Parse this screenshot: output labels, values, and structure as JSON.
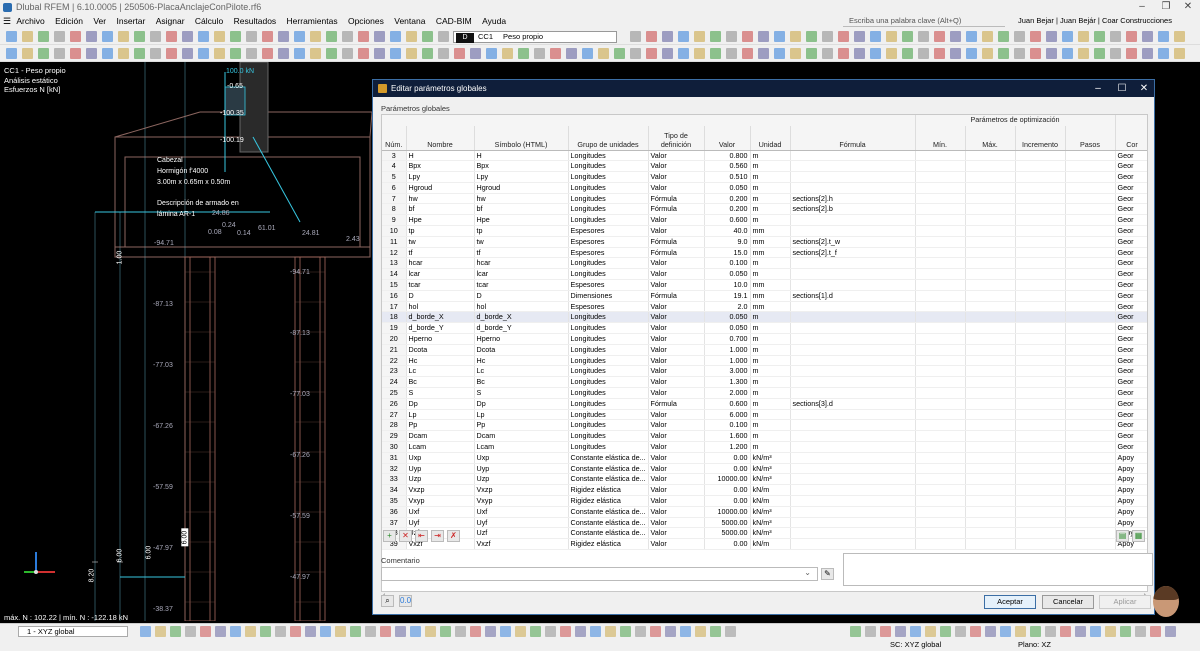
{
  "window": {
    "title": "Dlubal RFEM | 6.10.0005 | 250506-PlacaAnclajeConPilote.rf6",
    "controls": [
      "–",
      "❐",
      "✕"
    ]
  },
  "menu": {
    "items": [
      "Archivo",
      "Edición",
      "Ver",
      "Insertar",
      "Asignar",
      "Cálculo",
      "Resultados",
      "Herramientas",
      "Opciones",
      "Ventana",
      "CAD-BIM",
      "Ayuda"
    ]
  },
  "search": {
    "placeholder": "Escriba una palabra clave (Alt+Q)"
  },
  "user": {
    "label": "Juan Bejar | Juan Bejár | Coar Construcciones"
  },
  "loadcase": {
    "tag": "D",
    "code": "CC1",
    "name": "Peso propio"
  },
  "viewport_info": {
    "line1": "CC1 - Peso propio",
    "line2": "Análisis estático",
    "line3": "Esfuerzos N [kN]",
    "footer": "máx. N : 102.22 | mín. N : -122.18 kN"
  },
  "model_labels": {
    "box_title": "Cabezal",
    "box_material": "Hormigón f'4000",
    "box_dims": "3.00m x 0.65m x 0.50m",
    "rebar1": "Descripción de armado en",
    "rebar2": "lámina AR-1",
    "v1": "100.0 kN",
    "v2": "-0.65",
    "v3": "-100.35",
    "v4": "-100.19",
    "v5": "-94.71",
    "v6": "-94.71",
    "v7": "-87.13",
    "v8": "-87.13",
    "v9": "-77.03",
    "v10": "-77.03",
    "v11": "-67.26",
    "v12": "-67.26",
    "v13": "-57.59",
    "v14": "-57.59",
    "v15": "-47.97",
    "v16": "-47.97",
    "v17": "-38.37",
    "v18": "24.86",
    "v19": "0.08",
    "v20": "0.24",
    "v21": "0.14",
    "v22": "61.01",
    "v23": "24.81",
    "v24": "2.43",
    "d1": "1.00",
    "d2": "6.00",
    "d3": "6.00",
    "d4": "8.20",
    "d5": "6.00"
  },
  "status": {
    "view_combo": "1 - XYZ global",
    "sc": "SC: XYZ global",
    "plane": "Plano: XZ"
  },
  "dialog": {
    "title": "Editar parámetros globales",
    "section": "Parámetros globales",
    "columns": {
      "num": "Núm.",
      "name": "Nombre",
      "symbol": "Símbolo (HTML)",
      "group": "Grupo de unidades",
      "deftype": "Tipo de definición",
      "value": "Valor",
      "unit": "Unidad",
      "formula": "Fórmula",
      "opt_header": "Parámetros de optimización",
      "min": "Mín.",
      "max": "Máx.",
      "incr": "Incremento",
      "steps": "Pasos",
      "com": "Cor"
    },
    "rows": [
      [
        "3",
        "H",
        "H",
        "Longitudes",
        "Valor",
        "0.800",
        "m",
        "",
        "Geor"
      ],
      [
        "4",
        "Bpx",
        "Bpx",
        "Longitudes",
        "Valor",
        "0.560",
        "m",
        "",
        "Geor"
      ],
      [
        "5",
        "Lpy",
        "Lpy",
        "Longitudes",
        "Valor",
        "0.510",
        "m",
        "",
        "Geor"
      ],
      [
        "6",
        "Hgroud",
        "Hgroud",
        "Longitudes",
        "Valor",
        "0.050",
        "m",
        "",
        "Geor"
      ],
      [
        "7",
        "hw",
        "hw",
        "Longitudes",
        "Fórmula",
        "0.200",
        "m",
        "sections[2].h",
        "Geor"
      ],
      [
        "8",
        "bf",
        "bf",
        "Longitudes",
        "Fórmula",
        "0.200",
        "m",
        "sections[2].b",
        "Geor"
      ],
      [
        "9",
        "Hpe",
        "Hpe",
        "Longitudes",
        "Valor",
        "0.600",
        "m",
        "",
        "Geor"
      ],
      [
        "10",
        "tp",
        "tp",
        "Espesores",
        "Valor",
        "40.0",
        "mm",
        "",
        "Geor"
      ],
      [
        "11",
        "tw",
        "tw",
        "Espesores",
        "Fórmula",
        "9.0",
        "mm",
        "sections[2].t_w",
        "Geor"
      ],
      [
        "12",
        "tf",
        "tf",
        "Espesores",
        "Fórmula",
        "15.0",
        "mm",
        "sections[2].t_f",
        "Geor"
      ],
      [
        "13",
        "hcar",
        "hcar",
        "Longitudes",
        "Valor",
        "0.100",
        "m",
        "",
        "Geor"
      ],
      [
        "14",
        "lcar",
        "lcar",
        "Longitudes",
        "Valor",
        "0.050",
        "m",
        "",
        "Geor"
      ],
      [
        "15",
        "tcar",
        "tcar",
        "Espesores",
        "Valor",
        "10.0",
        "mm",
        "",
        "Geor"
      ],
      [
        "16",
        "D",
        "D",
        "Dimensiones",
        "Fórmula",
        "19.1",
        "mm",
        "sections[1].d",
        "Geor"
      ],
      [
        "17",
        "hol",
        "hol",
        "Espesores",
        "Valor",
        "2.0",
        "mm",
        "",
        "Geor"
      ],
      [
        "18",
        "d_borde_X",
        "d_borde_X",
        "Longitudes",
        "Valor",
        "0.050",
        "m",
        "",
        "Geor"
      ],
      [
        "19",
        "d_borde_Y",
        "d_borde_Y",
        "Longitudes",
        "Valor",
        "0.050",
        "m",
        "",
        "Geor"
      ],
      [
        "20",
        "Hperno",
        "Hperno",
        "Longitudes",
        "Valor",
        "0.700",
        "m",
        "",
        "Geor"
      ],
      [
        "21",
        "Dcota",
        "Dcota",
        "Longitudes",
        "Valor",
        "1.000",
        "m",
        "",
        "Geor"
      ],
      [
        "22",
        "Hc",
        "Hc",
        "Longitudes",
        "Valor",
        "1.000",
        "m",
        "",
        "Geor"
      ],
      [
        "23",
        "Lc",
        "Lc",
        "Longitudes",
        "Valor",
        "3.000",
        "m",
        "",
        "Geor"
      ],
      [
        "24",
        "Bc",
        "Bc",
        "Longitudes",
        "Valor",
        "1.300",
        "m",
        "",
        "Geor"
      ],
      [
        "25",
        "S",
        "S",
        "Longitudes",
        "Valor",
        "2.000",
        "m",
        "",
        "Geor"
      ],
      [
        "26",
        "Dp",
        "Dp",
        "Longitudes",
        "Fórmula",
        "0.600",
        "m",
        "sections[3].d",
        "Geor"
      ],
      [
        "27",
        "Lp",
        "Lp",
        "Longitudes",
        "Valor",
        "6.000",
        "m",
        "",
        "Geor"
      ],
      [
        "28",
        "Pp",
        "Pp",
        "Longitudes",
        "Valor",
        "0.100",
        "m",
        "",
        "Geor"
      ],
      [
        "29",
        "Dcam",
        "Dcam",
        "Longitudes",
        "Valor",
        "1.600",
        "m",
        "",
        "Geor"
      ],
      [
        "30",
        "Lcam",
        "Lcam",
        "Longitudes",
        "Valor",
        "1.200",
        "m",
        "",
        "Geor"
      ],
      [
        "31",
        "Uxp",
        "Uxp",
        "Constante elástica de...",
        "Valor",
        "0.00",
        "kN/m³",
        "",
        "Apoy"
      ],
      [
        "32",
        "Uyp",
        "Uyp",
        "Constante elástica de...",
        "Valor",
        "0.00",
        "kN/m³",
        "",
        "Apoy"
      ],
      [
        "33",
        "Uzp",
        "Uzp",
        "Constante elástica de...",
        "Valor",
        "10000.00",
        "kN/m³",
        "",
        "Apoy"
      ],
      [
        "34",
        "Vxzp",
        "Vxzp",
        "Rigidez elástica",
        "Valor",
        "0.00",
        "kN/m",
        "",
        "Apoy"
      ],
      [
        "35",
        "Vxyp",
        "Vxyp",
        "Rigidez elástica",
        "Valor",
        "0.00",
        "kN/m",
        "",
        "Apoy"
      ],
      [
        "36",
        "Uxf",
        "Uxf",
        "Constante elástica de...",
        "Valor",
        "10000.00",
        "kN/m³",
        "",
        "Apoy"
      ],
      [
        "37",
        "Uyf",
        "Uyf",
        "Constante elástica de...",
        "Valor",
        "5000.00",
        "kN/m³",
        "",
        "Apoy"
      ],
      [
        "38",
        "Uzf",
        "Uzf",
        "Constante elástica de...",
        "Valor",
        "5000.00",
        "kN/m³",
        "",
        "Apoy"
      ],
      [
        "39",
        "Vxzf",
        "Vxzf",
        "Rigidez elástica",
        "Valor",
        "0.00",
        "kN/m",
        "",
        "Apoy"
      ]
    ],
    "selected_row": "18",
    "comment_label": "Comentario",
    "buttons": {
      "ok": "Aceptar",
      "cancel": "Cancelar",
      "apply": "Aplicar"
    }
  },
  "colors": {
    "dialog_title_bg": "#0f1e3a",
    "selection": "#e6e9f3",
    "accent": "#3b6ea5"
  }
}
